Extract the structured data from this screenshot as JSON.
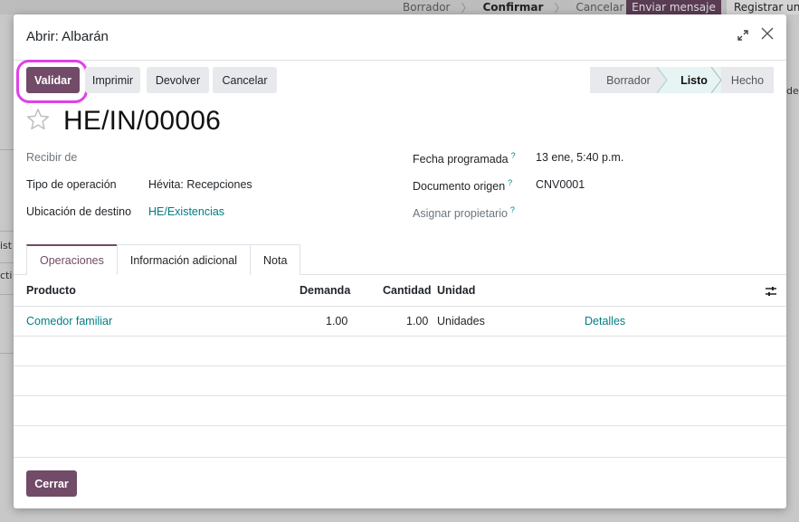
{
  "background": {
    "status_stages": [
      "Borrador",
      "Confirmar",
      "Cancelar"
    ],
    "send_message": "Enviar mensaje",
    "register": "Registrar una",
    "left_fragment_1": "ist",
    "left_fragment_2": "cti",
    "right_fragment": "de"
  },
  "dialog": {
    "title": "Abrir: Albarán",
    "expand_icon": "expand-icon",
    "close_icon": "close-icon"
  },
  "actions": {
    "validate": "Validar",
    "print": "Imprimir",
    "return": "Devolver",
    "cancel": "Cancelar"
  },
  "statusbar": {
    "stages": [
      "Borrador",
      "Listo",
      "Hecho"
    ],
    "active": "Listo"
  },
  "record": {
    "name": "HE/IN/00006",
    "favorite_icon": "star-icon"
  },
  "fields": {
    "receive_from_label": "Recibir de",
    "receive_from_value": "",
    "operation_type_label": "Tipo de operación",
    "operation_type_value": "Hévita: Recepciones",
    "dest_location_label": "Ubicación de destino",
    "dest_location_value": "HE/Existencias",
    "scheduled_date_label": "Fecha programada",
    "scheduled_date_value": "13 ene, 5:40 p.m.",
    "source_doc_label": "Documento origen",
    "source_doc_value": "CNV0001",
    "assign_owner_label": "Asignar propietario",
    "assign_owner_value": "",
    "help_mark": "?"
  },
  "tabs": [
    "Operaciones",
    "Información adicional",
    "Nota"
  ],
  "table": {
    "headers": {
      "product": "Producto",
      "demand": "Demanda",
      "quantity": "Cantidad",
      "unit": "Unidad"
    },
    "rows": [
      {
        "product": "Comedor familiar",
        "demand": "1.00",
        "quantity": "1.00",
        "unit": "Unidades",
        "details": "Detalles"
      }
    ]
  },
  "footer": {
    "close": "Cerrar"
  },
  "colors": {
    "primary": "#714b67",
    "link": "#017e84",
    "highlight": "#e040e8"
  }
}
